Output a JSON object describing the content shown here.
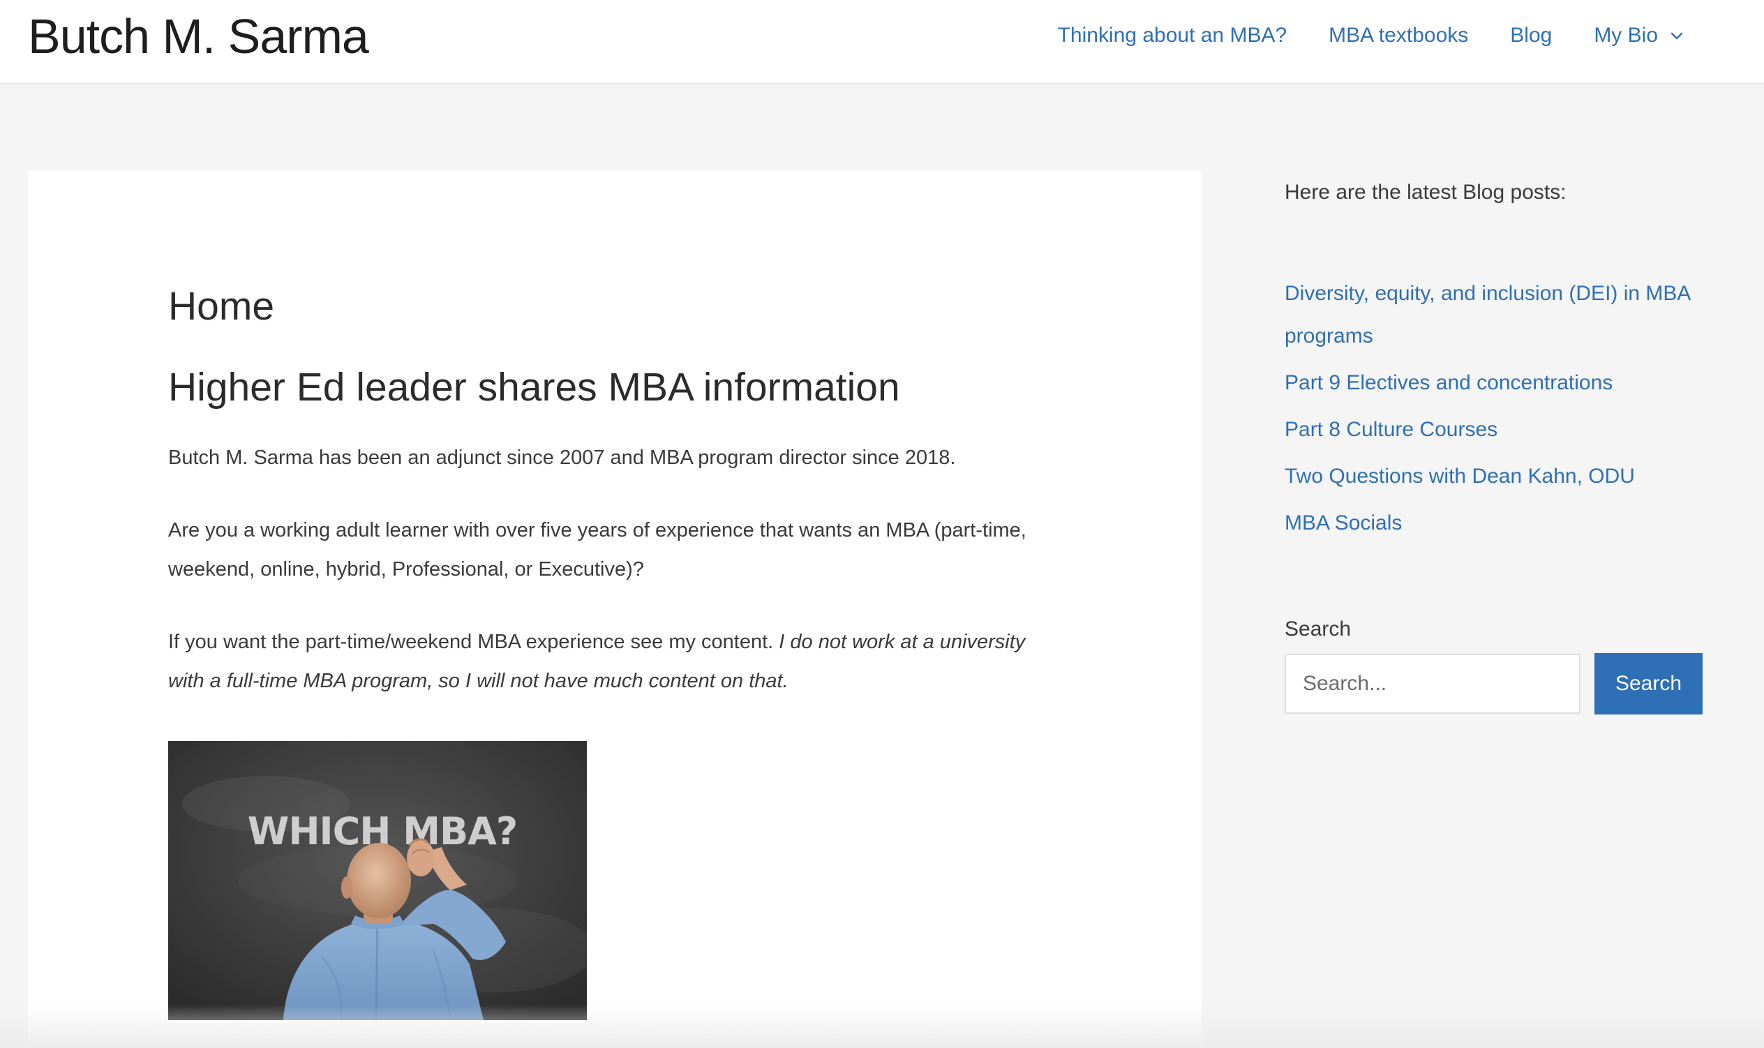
{
  "header": {
    "site_title": "Butch M. Sarma",
    "nav": [
      {
        "label": "Thinking about an MBA?"
      },
      {
        "label": "MBA textbooks"
      },
      {
        "label": "Blog"
      },
      {
        "label": "My Bio",
        "icon": "chevron-down-icon"
      }
    ]
  },
  "main": {
    "page_title": "Home",
    "post_heading": "Higher Ed leader shares MBA information",
    "paragraph1": "Butch M. Sarma has been an adjunct since 2007 and MBA program director since 2018.",
    "paragraph2": "Are you a working adult learner with over five years of experience that wants an MBA (part-time, weekend, online, hybrid, Professional, or Executive)?",
    "paragraph3_normal": "If you want the part-time/weekend MBA experience see my content. ",
    "paragraph3_italic": "I do not work at a university with a full-time MBA program, so I will not have much content on that.",
    "image": {
      "chalk_text": "WHICH MBA?"
    }
  },
  "sidebar": {
    "intro": "Here are the latest Blog posts:",
    "posts": [
      "Diversity, equity, and inclusion (DEI) in MBA programs",
      "Part 9 Electives and concentrations",
      "Part 8 Culture Courses",
      "Two Questions with Dean Kahn, ODU",
      "MBA Socials"
    ],
    "search": {
      "label": "Search",
      "placeholder": "Search...",
      "button_label": "Search"
    }
  },
  "colors": {
    "link": "#2e6fb5",
    "page_bg": "#f5f5f5",
    "button_bg": "#2e6fb5"
  }
}
